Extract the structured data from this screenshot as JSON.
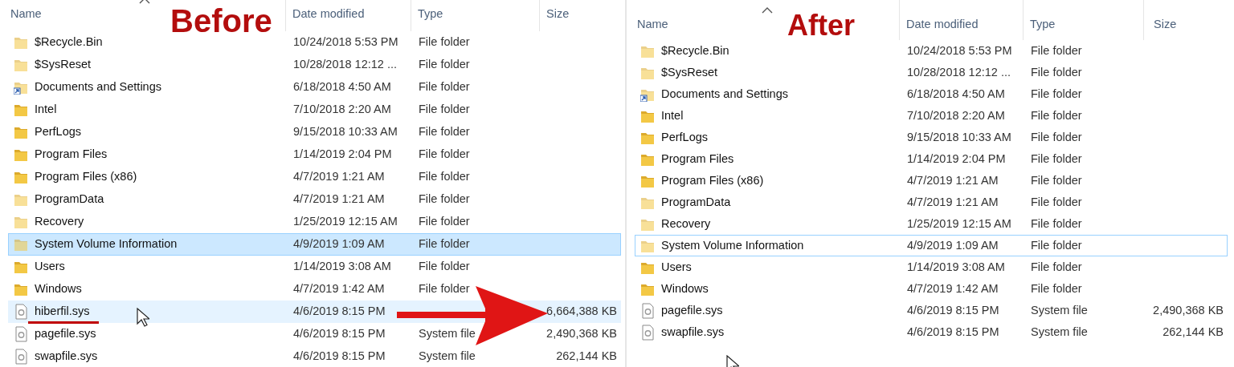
{
  "panes": [
    {
      "label": "Before",
      "columns": [
        "Name",
        "Date modified",
        "Type",
        "Size"
      ],
      "rows": [
        {
          "name": "$Recycle.Bin",
          "date": "10/24/2018 5:53 PM",
          "type": "File folder",
          "kind": "folder",
          "hidden": true,
          "selected": false,
          "hovered": false
        },
        {
          "name": "$SysReset",
          "date": "10/28/2018 12:12 ...",
          "type": "File folder",
          "kind": "folder",
          "hidden": true,
          "selected": false,
          "hovered": false
        },
        {
          "name": "Documents and Settings",
          "date": "6/18/2018 4:50 AM",
          "type": "File folder",
          "kind": "shortcut",
          "hidden": true,
          "selected": false,
          "hovered": false
        },
        {
          "name": "Intel",
          "date": "7/10/2018 2:20 AM",
          "type": "File folder",
          "kind": "folder",
          "hidden": false,
          "selected": false,
          "hovered": false
        },
        {
          "name": "PerfLogs",
          "date": "9/15/2018 10:33 AM",
          "type": "File folder",
          "kind": "folder",
          "hidden": false,
          "selected": false,
          "hovered": false
        },
        {
          "name": "Program Files",
          "date": "1/14/2019 2:04 PM",
          "type": "File folder",
          "kind": "folder",
          "hidden": false,
          "selected": false,
          "hovered": false
        },
        {
          "name": "Program Files (x86)",
          "date": "4/7/2019 1:21 AM",
          "type": "File folder",
          "kind": "folder",
          "hidden": false,
          "selected": false,
          "hovered": false
        },
        {
          "name": "ProgramData",
          "date": "4/7/2019 1:21 AM",
          "type": "File folder",
          "kind": "folder",
          "hidden": true,
          "selected": false,
          "hovered": false
        },
        {
          "name": "Recovery",
          "date": "1/25/2019 12:15 AM",
          "type": "File folder",
          "kind": "folder",
          "hidden": true,
          "selected": false,
          "hovered": false
        },
        {
          "name": "System Volume Information",
          "date": "4/9/2019 1:09 AM",
          "type": "File folder",
          "kind": "folder",
          "hidden": true,
          "selected": true,
          "hovered": false
        },
        {
          "name": "Users",
          "date": "1/14/2019 3:08 AM",
          "type": "File folder",
          "kind": "folder",
          "hidden": false,
          "selected": false,
          "hovered": false
        },
        {
          "name": "Windows",
          "date": "4/7/2019 1:42 AM",
          "type": "File folder",
          "kind": "folder",
          "hidden": false,
          "selected": false,
          "hovered": false
        },
        {
          "name": "hiberfil.sys",
          "date": "4/6/2019 8:15 PM",
          "size": "6,664,388 KB",
          "kind": "file",
          "hidden": false,
          "selected": false,
          "hovered": true
        },
        {
          "name": "pagefile.sys",
          "date": "4/6/2019 8:15 PM",
          "type": "System file",
          "size": "2,490,368 KB",
          "kind": "file",
          "hidden": false,
          "selected": false,
          "hovered": false
        },
        {
          "name": "swapfile.sys",
          "date": "4/6/2019 8:15 PM",
          "type": "System file",
          "size": "262,144 KB",
          "kind": "file",
          "hidden": false,
          "selected": false,
          "hovered": false
        }
      ]
    },
    {
      "label": "After",
      "columns": [
        "Name",
        "Date modified",
        "Type",
        "Size"
      ],
      "rows": [
        {
          "name": "$Recycle.Bin",
          "date": "10/24/2018 5:53 PM",
          "type": "File folder",
          "kind": "folder",
          "hidden": true,
          "selected": false,
          "focused": false
        },
        {
          "name": "$SysReset",
          "date": "10/28/2018 12:12 ...",
          "type": "File folder",
          "kind": "folder",
          "hidden": true,
          "selected": false,
          "focused": false
        },
        {
          "name": "Documents and Settings",
          "date": "6/18/2018 4:50 AM",
          "type": "File folder",
          "kind": "shortcut",
          "hidden": true,
          "selected": false,
          "focused": false
        },
        {
          "name": "Intel",
          "date": "7/10/2018 2:20 AM",
          "type": "File folder",
          "kind": "folder",
          "hidden": false,
          "selected": false,
          "focused": false
        },
        {
          "name": "PerfLogs",
          "date": "9/15/2018 10:33 AM",
          "type": "File folder",
          "kind": "folder",
          "hidden": false,
          "selected": false,
          "focused": false
        },
        {
          "name": "Program Files",
          "date": "1/14/2019 2:04 PM",
          "type": "File folder",
          "kind": "folder",
          "hidden": false,
          "selected": false,
          "focused": false
        },
        {
          "name": "Program Files (x86)",
          "date": "4/7/2019 1:21 AM",
          "type": "File folder",
          "kind": "folder",
          "hidden": false,
          "selected": false,
          "focused": false
        },
        {
          "name": "ProgramData",
          "date": "4/7/2019 1:21 AM",
          "type": "File folder",
          "kind": "folder",
          "hidden": true,
          "selected": false,
          "focused": false
        },
        {
          "name": "Recovery",
          "date": "1/25/2019 12:15 AM",
          "type": "File folder",
          "kind": "folder",
          "hidden": true,
          "selected": false,
          "focused": false
        },
        {
          "name": "System Volume Information",
          "date": "4/9/2019 1:09 AM",
          "type": "File folder",
          "kind": "folder",
          "hidden": true,
          "selected": false,
          "focused": true
        },
        {
          "name": "Users",
          "date": "1/14/2019 3:08 AM",
          "type": "File folder",
          "kind": "folder",
          "hidden": false,
          "selected": false,
          "focused": false
        },
        {
          "name": "Windows",
          "date": "4/7/2019 1:42 AM",
          "type": "File folder",
          "kind": "folder",
          "hidden": false,
          "selected": false,
          "focused": false
        },
        {
          "name": "pagefile.sys",
          "date": "4/6/2019 8:15 PM",
          "type": "System file",
          "size": "2,490,368 KB",
          "kind": "file",
          "hidden": false,
          "selected": false,
          "focused": false
        },
        {
          "name": "swapfile.sys",
          "date": "4/6/2019 8:15 PM",
          "type": "System file",
          "size": "262,144 KB",
          "kind": "file",
          "hidden": false,
          "selected": false,
          "focused": false
        }
      ]
    }
  ]
}
